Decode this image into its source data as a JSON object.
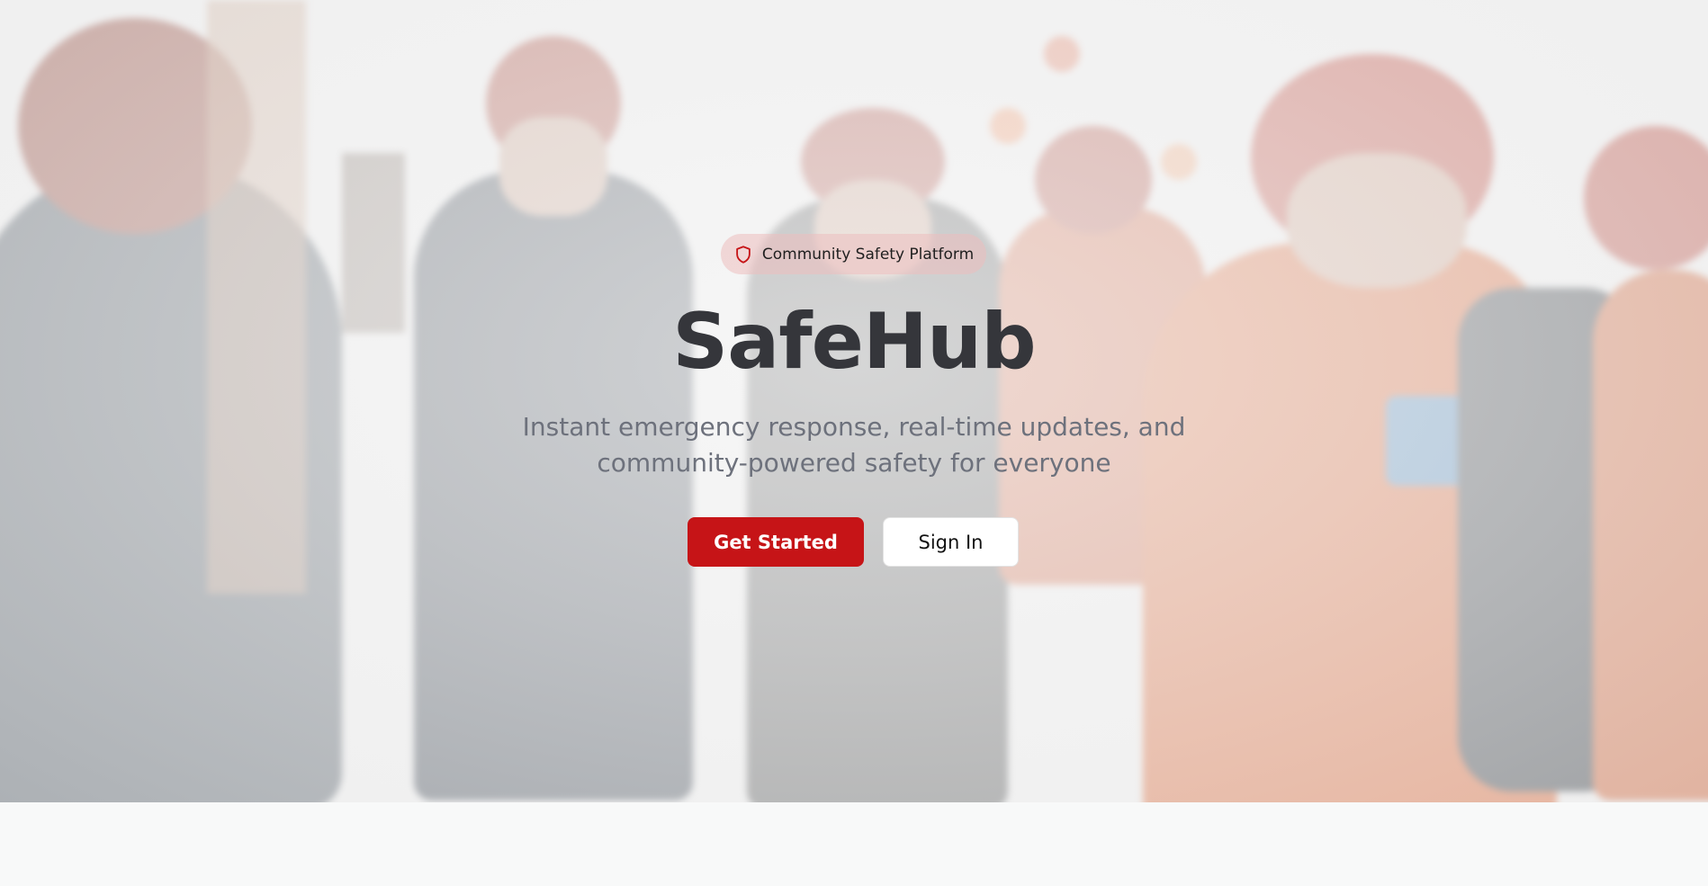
{
  "hero": {
    "badge": {
      "label": "Community Safety Platform",
      "icon": "shield-icon"
    },
    "title": "SafeHub",
    "subtitle": "Instant emergency response, real-time updates, and community-powered safety for everyone",
    "buttons": {
      "primary_label": "Get Started",
      "secondary_label": "Sign In"
    },
    "background_image": "blurred photo of emergency responders in helmets and orange jackets"
  },
  "colors": {
    "accent": "#c61417",
    "title": "#35363b",
    "subtitle": "#6d717c",
    "badge_bg": "#f0c8c8",
    "page_bg": "#f8f9f9"
  }
}
